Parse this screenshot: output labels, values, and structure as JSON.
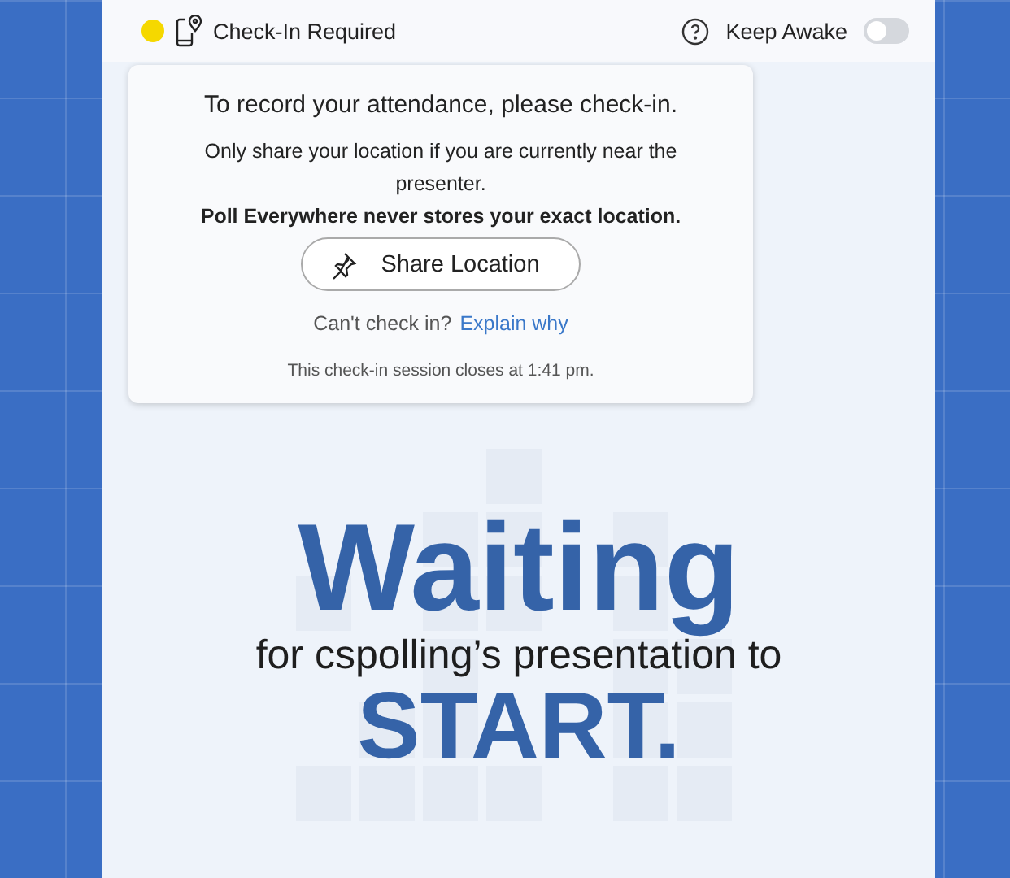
{
  "header": {
    "status": {
      "color": "#f5d800"
    },
    "title": "Check-In Required",
    "keep_awake": {
      "label": "Keep Awake",
      "on": false
    }
  },
  "checkin": {
    "heading": "To record your attendance, please check-in.",
    "note": "Only share your location if you are currently near the presenter.",
    "privacy": "Poll Everywhere never stores your exact location.",
    "button": "Share Location",
    "help_prompt": "Can't check in?",
    "help_link": "Explain why",
    "closing": "This check-in session closes at 1:41 pm."
  },
  "waiting": {
    "title": "Waiting",
    "subtitle": "for cspolling’s presentation to",
    "end": "START."
  }
}
